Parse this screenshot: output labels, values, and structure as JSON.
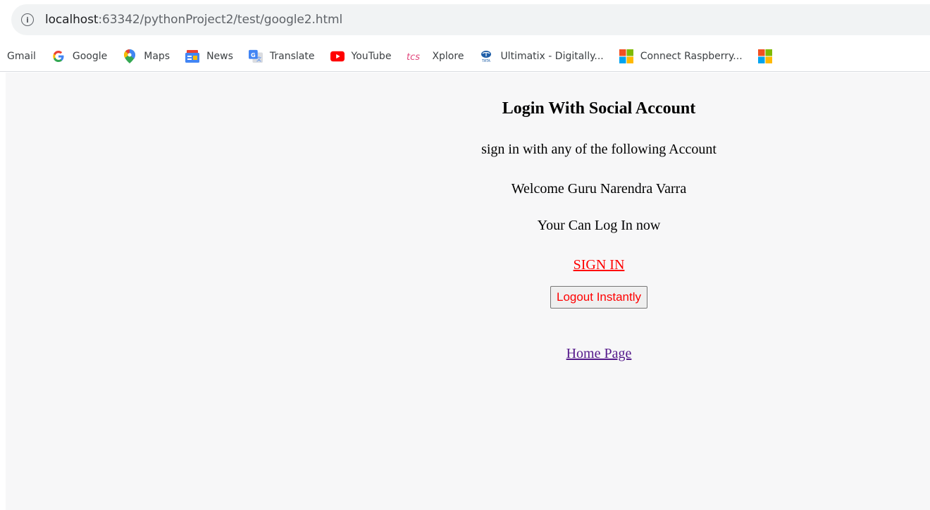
{
  "browser": {
    "url_host": "localhost",
    "url_rest": ":63342/pythonProject2/test/google2.html"
  },
  "bookmarks": [
    {
      "label": "Gmail",
      "icon": "gmail-icon"
    },
    {
      "label": "Google",
      "icon": "google-icon"
    },
    {
      "label": "Maps",
      "icon": "maps-icon"
    },
    {
      "label": "News",
      "icon": "news-icon"
    },
    {
      "label": "Translate",
      "icon": "translate-icon"
    },
    {
      "label": "YouTube",
      "icon": "youtube-icon"
    },
    {
      "label": "Xplore",
      "icon": "tcs-icon"
    },
    {
      "label": "Ultimatix - Digitally...",
      "icon": "tata-icon"
    },
    {
      "label": "Connect Raspberry...",
      "icon": "microsoft-icon"
    }
  ],
  "page": {
    "title": "Login With Social Account",
    "subtitle": "sign in with any of the following Account",
    "welcome": "Welcome Guru Narendra Varra",
    "status": "Your Can Log In now",
    "signin_link": "SIGN IN",
    "logout_button": "Logout Instantly",
    "home_link": "Home Page"
  },
  "colors": {
    "signin": "#ff0000",
    "logout_text": "#ff0000",
    "visited_link": "#551a8b",
    "page_bg": "#f7f7f8"
  }
}
